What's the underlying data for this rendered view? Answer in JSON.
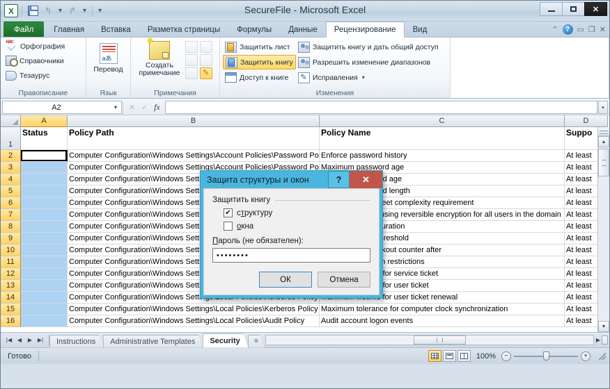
{
  "window": {
    "title": "SecureFile  -  Microsoft Excel",
    "minimize": "—",
    "maximize": "▢",
    "close": "✕"
  },
  "quick_access": {
    "logo": "X",
    "save": "save-icon",
    "undo": "↰",
    "redo": "↱",
    "customize": "▾"
  },
  "ribbon": {
    "tabs": [
      {
        "label": "Файл",
        "kind": "file"
      },
      {
        "label": "Главная",
        "kind": "normal"
      },
      {
        "label": "Вставка",
        "kind": "normal"
      },
      {
        "label": "Разметка страницы",
        "kind": "normal"
      },
      {
        "label": "Формулы",
        "kind": "normal"
      },
      {
        "label": "Данные",
        "kind": "normal"
      },
      {
        "label": "Рецензирование",
        "kind": "active"
      },
      {
        "label": "Вид",
        "kind": "normal"
      }
    ],
    "right_controls": {
      "collapse": "⌃",
      "help": "?",
      "restore_down": "▭",
      "restore": "❐",
      "close_window": "✕"
    },
    "groups": [
      {
        "label": "Правописание",
        "items": [
          {
            "label": "Орфография",
            "icon": "spelling-icon"
          },
          {
            "label": "Справочники",
            "icon": "reference-books-icon"
          },
          {
            "label": "Тезаурус",
            "icon": "thesaurus-icon"
          }
        ]
      },
      {
        "label": "Язык",
        "items": [
          {
            "label": "Перевод",
            "icon": "translate-icon"
          }
        ]
      },
      {
        "label": "Примечания",
        "items": [
          {
            "label": "Создать\nпримечание",
            "icon": "new-comment-icon"
          }
        ],
        "label_line1": "Создать",
        "label_line2": "примечание"
      },
      {
        "label": "Изменения",
        "items": [
          {
            "label": "Защитить лист",
            "icon": "protect-sheet-icon"
          },
          {
            "label": "Защитить книгу",
            "icon": "protect-workbook-icon",
            "highlighted": true
          },
          {
            "label": "Доступ к книге",
            "icon": "share-workbook-icon"
          },
          {
            "label": "Защитить книгу и дать общий доступ",
            "icon": "protect-share-icon"
          },
          {
            "label": "Разрешить изменение диапазонов",
            "icon": "allow-edit-ranges-icon"
          },
          {
            "label": "Исправления",
            "icon": "track-changes-icon",
            "caret": "▾"
          }
        ]
      }
    ]
  },
  "formula_bar": {
    "name_box": "A2",
    "name_box_caret": "▾",
    "cancel": "✕",
    "enter": "✓",
    "insert_function": "fx",
    "formula_value": "",
    "expand": "▾"
  },
  "grid": {
    "columns": [
      "A",
      "B",
      "C",
      "D"
    ],
    "selected_column": "A",
    "active_cell": "A2",
    "headers": {
      "A": "Status",
      "B": "Policy Path",
      "C": "Policy Name",
      "D": "Suppo"
    },
    "rows": [
      {
        "n": "1",
        "a": "",
        "b": "",
        "c": "",
        "d": ""
      },
      {
        "n": "2",
        "a": "",
        "b": "Computer Configuration\\Windows Settings\\Account Policies\\Password Poli",
        "c": "Enforce password history",
        "d": "At least"
      },
      {
        "n": "3",
        "a": "",
        "b": "Computer Configuration\\Windows Settings\\Account Policies\\Password Policy",
        "c": "Maximum password age",
        "d": "At least"
      },
      {
        "n": "4",
        "a": "",
        "b": "Computer Configuration\\Windows Settings\\Account Policies\\Password Policy",
        "c": "Minimum password age",
        "d": "At least"
      },
      {
        "n": "5",
        "a": "",
        "b": "Computer Configuration\\Windows Settings\\Account Policies\\Password Policy",
        "c": "Minimum password length",
        "d": "At least"
      },
      {
        "n": "6",
        "a": "",
        "b": "Computer Configuration\\Windows Settings\\Account Policies\\Password Policy",
        "c": "Password must meet complexity requirement",
        "d": "At least"
      },
      {
        "n": "7",
        "a": "",
        "b": "Computer Configuration\\Windows Settings\\Account Policies\\Password Policy",
        "c": "Store passwords using reversible encryption for all users in the domain",
        "d": "At least"
      },
      {
        "n": "8",
        "a": "",
        "b": "Computer Configuration\\Windows Settings\\Account Policies\\Lockout Policy",
        "c": "Account lockout duration",
        "d": "At least"
      },
      {
        "n": "9",
        "a": "",
        "b": "Computer Configuration\\Windows Settings\\Account Policies\\Lockout Policy",
        "c": "Account lockout threshold",
        "d": "At least"
      },
      {
        "n": "10",
        "a": "",
        "b": "Computer Configuration\\Windows Settings\\Account Policies\\Lockout Policy",
        "c": "Reset account lockout counter after",
        "d": "At least"
      },
      {
        "n": "11",
        "a": "",
        "b": "Computer Configuration\\Windows Settings\\Local Policies\\Kerberos Policy",
        "c": "Enforce user logon restrictions",
        "d": "At least"
      },
      {
        "n": "12",
        "a": "",
        "b": "Computer Configuration\\Windows Settings\\Local Policies\\Kerberos Policy",
        "c": "Maximum lifetime for service ticket",
        "d": "At least"
      },
      {
        "n": "13",
        "a": "",
        "b": "Computer Configuration\\Windows Settings\\Local Policies\\Kerberos Policy",
        "c": "Maximum lifetime for user ticket",
        "d": "At least"
      },
      {
        "n": "14",
        "a": "",
        "b": "Computer Configuration\\Windows Settings\\Local Policies\\Kerberos Policy",
        "c": "Maximum lifetime for user ticket renewal",
        "d": "At least"
      },
      {
        "n": "15",
        "a": "",
        "b": "Computer Configuration\\Windows Settings\\Local Policies\\Kerberos Policy",
        "c": "Maximum tolerance for computer clock synchronization",
        "d": "At least"
      },
      {
        "n": "16",
        "a": "",
        "b": "Computer Configuration\\Windows Settings\\Local Policies\\Audit Policy",
        "c": "Audit account logon events",
        "d": "At least"
      }
    ]
  },
  "sheet_tabs": {
    "nav": {
      "first": "|◀",
      "prev": "◀",
      "next": "▶",
      "last": "▶|"
    },
    "tabs": [
      {
        "label": "Instructions",
        "active": false
      },
      {
        "label": "Administrative Templates",
        "active": false
      },
      {
        "label": "Security",
        "active": true
      }
    ],
    "new_sheet": "✳"
  },
  "status_bar": {
    "state": "Готово",
    "views": [
      {
        "name": "normal-view",
        "active": true
      },
      {
        "name": "page-layout-view",
        "active": false
      },
      {
        "name": "page-break-view",
        "active": false
      }
    ],
    "zoom": "100%",
    "zoom_out": "−",
    "zoom_in": "+"
  },
  "dialog": {
    "title": "Защита структуры и окон",
    "help_button": "?",
    "close_button": "✕",
    "group_label": "Защитить книгу",
    "checkboxes": [
      {
        "label_pre": "с",
        "label_key": "т",
        "label_post": "руктуру",
        "checked": true,
        "mark": "✔"
      },
      {
        "label_pre": "",
        "label_key": "о",
        "label_post": "кна",
        "checked": false,
        "mark": ""
      }
    ],
    "password_label_key": "П",
    "password_label_rest": "ароль (не обязателен):",
    "password_value": "••••••••",
    "ok_button": "ОК",
    "cancel_button": "Отмена"
  },
  "colors": {
    "excel_green": "#1d6b2b",
    "dialog_title_bg": "#4ab6dd",
    "dialog_close_bg": "#c0564a",
    "selection_blue": "#aed2f2",
    "header_gold": "#ffd265"
  }
}
